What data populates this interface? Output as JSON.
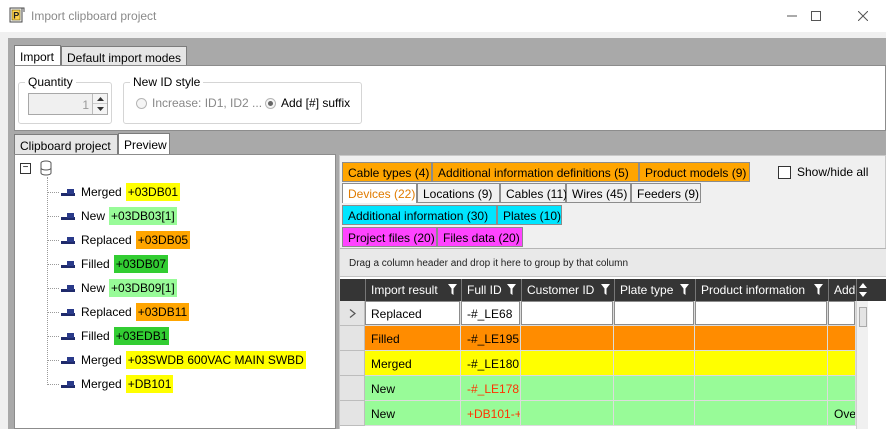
{
  "window": {
    "title": "Import clipboard project",
    "app_icon": "project-p-icon",
    "controls": [
      "minimize-icon",
      "maximize-icon",
      "close-icon"
    ]
  },
  "top_tabs": [
    {
      "label": "Import",
      "active": true
    },
    {
      "label": "Default import modes",
      "active": false
    }
  ],
  "quantity": {
    "label": "Quantity",
    "value": "1"
  },
  "id_style": {
    "label": "New ID style",
    "options": [
      {
        "label": "Increase: ID1, ID2 ...",
        "selected": false,
        "enabled": false
      },
      {
        "label": "Add [#] suffix",
        "selected": true,
        "enabled": true
      }
    ]
  },
  "sub_tabs": [
    {
      "label": "Clipboard project",
      "active": false
    },
    {
      "label": "Preview",
      "active": true
    }
  ],
  "tree": {
    "root_icon": "database-icon",
    "items": [
      {
        "status": "Merged",
        "id": "+03DB01",
        "color": "#ffff00"
      },
      {
        "status": "New",
        "id": "+03DB03[1]",
        "color": "#98fb98"
      },
      {
        "status": "Replaced",
        "id": "+03DB05",
        "color": "#ffa500"
      },
      {
        "status": "Filled",
        "id": "+03DB07",
        "color": "#32cd32"
      },
      {
        "status": "New",
        "id": "+03DB09[1]",
        "color": "#98fb98"
      },
      {
        "status": "Replaced",
        "id": "+03DB11",
        "color": "#ffa500"
      },
      {
        "status": "Filled",
        "id": "+03EDB1",
        "color": "#32cd32"
      },
      {
        "status": "Merged",
        "id": "+03SWDB 600VAC MAIN SWBD",
        "color": "#ffff00"
      },
      {
        "status": "Merged",
        "id": "+DB101",
        "color": "#ffff00"
      }
    ]
  },
  "category_tabs": [
    [
      {
        "label": "Cable types (4)",
        "color": "#ffa500",
        "active": false
      },
      {
        "label": "Additional information definitions (5)",
        "color": "#ffa500",
        "active": false
      },
      {
        "label": "Product models (9)",
        "color": "#ffa500",
        "active": false
      }
    ],
    [
      {
        "label": "Devices (22)",
        "color": "#ffffff",
        "active": true
      },
      {
        "label": "Locations (9)",
        "color": "#f0f0f0",
        "active": false
      },
      {
        "label": "Cables (11)",
        "color": "#f0f0f0",
        "active": false
      },
      {
        "label": "Wires (45)",
        "color": "#f0f0f0",
        "active": false
      },
      {
        "label": "Feeders (9)",
        "color": "#f0f0f0",
        "active": false
      }
    ],
    [
      {
        "label": "Additional information (30)",
        "color": "#00e5ff",
        "active": false
      },
      {
        "label": "Plates (10)",
        "color": "#00e5ff",
        "active": false
      }
    ],
    [
      {
        "label": "Project files (20)",
        "color": "#ff44ff",
        "active": false
      },
      {
        "label": "Files data (20)",
        "color": "#ff44ff",
        "active": false
      }
    ]
  ],
  "show_hide_all": {
    "label": "Show/hide all",
    "checked": false
  },
  "grid": {
    "group_hint": "Drag a column header and drop it here to group by that column",
    "columns": [
      "Import result",
      "Full ID",
      "Customer ID",
      "Plate type",
      "Product information",
      "Add"
    ],
    "rows": [
      {
        "result": "Replaced",
        "full_id": "-#_LE68",
        "extra": "",
        "color": "#ffffff",
        "id_color": "#000000",
        "current": true
      },
      {
        "result": "Filled",
        "full_id": "-#_LE195",
        "extra": "",
        "color": "#ff8c00",
        "id_color": "#000000",
        "current": false
      },
      {
        "result": "Merged",
        "full_id": "-#_LE180",
        "extra": "",
        "color": "#ffff00",
        "id_color": "#000000",
        "current": false
      },
      {
        "result": "New",
        "full_id": "-#_LE178|",
        "extra": "",
        "color": "#98fb98",
        "id_color": "#ff3300",
        "current": false
      },
      {
        "result": "New",
        "full_id": "+DB101-+",
        "extra": "Ove",
        "color": "#98fb98",
        "id_color": "#ff3300",
        "current": false
      }
    ]
  }
}
